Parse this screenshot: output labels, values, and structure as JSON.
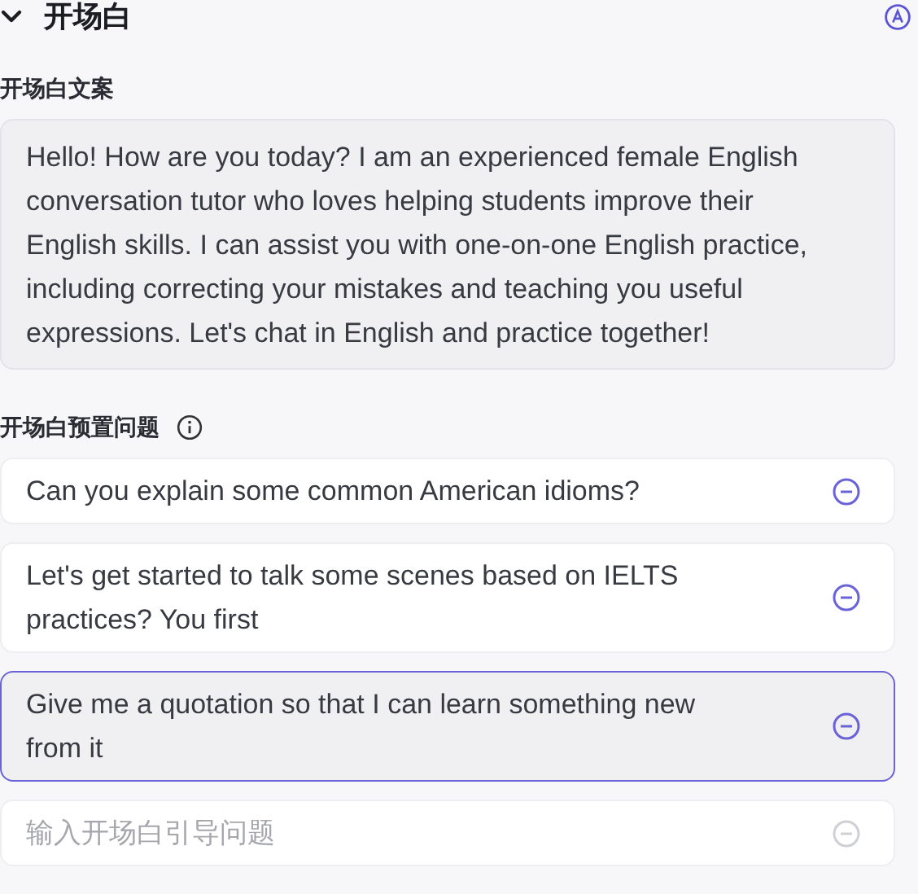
{
  "section": {
    "title": "开场白",
    "expanded": true
  },
  "opening_text": {
    "label": "开场白文案",
    "value": "Hello! How are you today? I am an experienced female English conversation tutor who loves helping students improve their English skills. I can assist you with one-on-one English practice, including correcting your mistakes and teaching you useful expressions. Let's chat in English and practice together!"
  },
  "preset_questions": {
    "label": "开场白预置问题",
    "items": [
      {
        "kind": "question",
        "text": "Can you explain some common American idioms?",
        "selected": false,
        "remove_disabled": false
      },
      {
        "kind": "question",
        "text": "Let's get started to talk some scenes based on IELTS practices? You first",
        "selected": false,
        "remove_disabled": false
      },
      {
        "kind": "question",
        "text": "Give me a quotation so that I can learn something new from it",
        "selected": true,
        "remove_disabled": false
      },
      {
        "kind": "input",
        "placeholder": "输入开场白引导问题",
        "selected": false,
        "remove_disabled": true
      }
    ]
  }
}
